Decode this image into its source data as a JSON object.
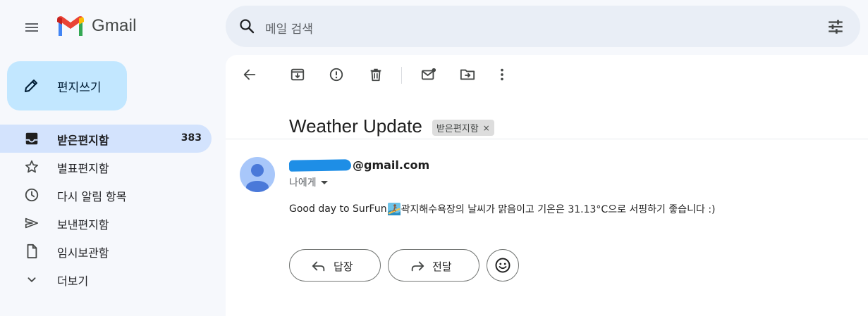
{
  "app": {
    "name": "Gmail",
    "search_placeholder": "메일 검색"
  },
  "compose": {
    "label": "편지쓰기"
  },
  "sidebar": {
    "items": [
      {
        "label": "받은편지함",
        "count": "383",
        "icon": "inbox-icon",
        "active": true
      },
      {
        "label": "별표편지함",
        "count": "",
        "icon": "star-icon",
        "active": false
      },
      {
        "label": "다시 알림 항목",
        "count": "",
        "icon": "clock-icon",
        "active": false
      },
      {
        "label": "보낸편지함",
        "count": "",
        "icon": "send-icon",
        "active": false
      },
      {
        "label": "임시보관함",
        "count": "",
        "icon": "draft-icon",
        "active": false
      },
      {
        "label": "더보기",
        "count": "",
        "icon": "chevron-down-icon",
        "active": false
      }
    ]
  },
  "message": {
    "subject": "Weather Update",
    "label_chip": "받은편지함",
    "label_chip_remove": "×",
    "sender_visible": "@gmail.com",
    "recipient": "나에게",
    "body_before_emoji": "Good day to SurFun",
    "body_after_emoji": " 곽지해수욕장의 날씨가 맑음이고 기온은 31.13°C으로 서핑하기 좋습니다 :)"
  },
  "actions": {
    "reply_label": "답장",
    "forward_label": "전달"
  },
  "colors": {
    "background": "#f6f8fc",
    "compose": "#c2e7ff",
    "active_nav": "#d3e3fd",
    "search": "#e9eef6",
    "avatar": "#a8c7fa",
    "redaction": "#1e8ee6"
  }
}
